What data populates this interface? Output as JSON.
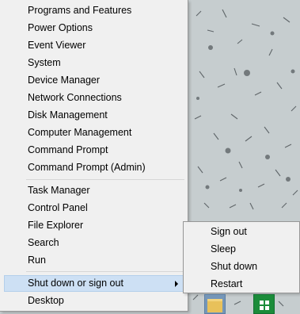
{
  "menu": {
    "group1": [
      {
        "label": "Programs and Features"
      },
      {
        "label": "Power Options"
      },
      {
        "label": "Event Viewer"
      },
      {
        "label": "System"
      },
      {
        "label": "Device Manager"
      },
      {
        "label": "Network Connections"
      },
      {
        "label": "Disk Management"
      },
      {
        "label": "Computer Management"
      },
      {
        "label": "Command Prompt"
      },
      {
        "label": "Command Prompt (Admin)"
      }
    ],
    "group2": [
      {
        "label": "Task Manager"
      },
      {
        "label": "Control Panel"
      },
      {
        "label": "File Explorer"
      },
      {
        "label": "Search"
      },
      {
        "label": "Run"
      }
    ],
    "shutdown_label": "Shut down or sign out",
    "desktop_label": "Desktop"
  },
  "submenu": {
    "items": [
      {
        "label": "Sign out"
      },
      {
        "label": "Sleep"
      },
      {
        "label": "Shut down"
      },
      {
        "label": "Restart"
      }
    ]
  },
  "taskbar": {
    "icons": [
      "file-explorer-icon",
      "store-icon"
    ]
  },
  "colors": {
    "menu_bg": "#f0f0f0",
    "highlight": "#cde0f4",
    "highlight_border": "#b4cfeb",
    "store_green": "#1b8c3a"
  }
}
